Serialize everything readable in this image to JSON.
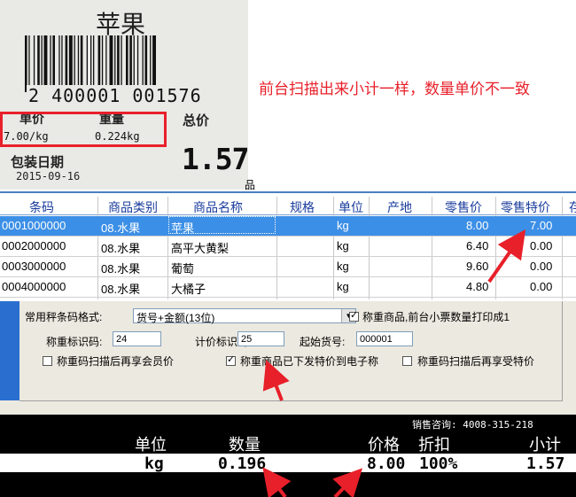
{
  "label_photo": {
    "product_name": "苹果",
    "barcode_digits": "2 400001 001576",
    "unit_price_label": "单价",
    "weight_label": "重量",
    "total_label": "总价",
    "unit_price_value": "7.00/kg",
    "weight_value": "0.224kg",
    "total_value": "1.57",
    "pack_date_label": "包装日期",
    "pack_date_value": "2015-09-16"
  },
  "annotation": "前台扫描出来小计一样，数量单价不一致",
  "grid": {
    "caption": "品",
    "columns": [
      "条码",
      "商品类别",
      "商品名称",
      "规格",
      "单位",
      "产地",
      "零售价",
      "零售特价",
      "存"
    ],
    "rows": [
      {
        "barcode": "0001000000",
        "category": "08.水果",
        "name": "苹果",
        "spec": "",
        "unit": "kg",
        "origin": "",
        "retail_price": "8.00",
        "special_price": "7.00",
        "selected": true
      },
      {
        "barcode": "0002000000",
        "category": "08.水果",
        "name": "高平大黄梨",
        "spec": "",
        "unit": "kg",
        "origin": "",
        "retail_price": "6.40",
        "special_price": "0.00",
        "selected": false
      },
      {
        "barcode": "0003000000",
        "category": "08.水果",
        "name": "葡萄",
        "spec": "",
        "unit": "kg",
        "origin": "",
        "retail_price": "9.60",
        "special_price": "0.00",
        "selected": false
      },
      {
        "barcode": "0004000000",
        "category": "08.水果",
        "name": "大橘子",
        "spec": "",
        "unit": "kg",
        "origin": "",
        "retail_price": "4.80",
        "special_price": "0.00",
        "selected": false
      }
    ]
  },
  "settings": {
    "format_label": "常用秤条码格式:",
    "format_value": "货号+金额(13位)",
    "receipt_check_label": "称重商品,前台小票数量打印成1",
    "receipt_check_on": true,
    "weigh_id_label": "称重标识码:",
    "weigh_id_value": "24",
    "price_id_label": "计价标识码:",
    "price_id_value": "25",
    "start_code_label": "起始货号:",
    "start_code_value": "000001",
    "member_price_label": "称重码扫描后再享会员价",
    "member_price_on": false,
    "send_special_label": "称重商品已下发特价到电子称",
    "send_special_on": true,
    "special_price_label": "称重码扫描后再享受特价",
    "special_price_on": false
  },
  "pos_display": {
    "hotline": "销售咨询: 4008-315-218",
    "headers": {
      "unit": "单位",
      "qty": "数量",
      "price": "价格",
      "discount": "折扣",
      "subtotal": "小计"
    },
    "values": {
      "unit": "kg",
      "qty": "0.196",
      "price": "8.00",
      "discount": "100%",
      "subtotal": "1.57"
    }
  },
  "colors": {
    "annotation_red": "#e8202a",
    "selection_blue": "#3c8fe6",
    "header_blue": "#1a3c9c"
  }
}
